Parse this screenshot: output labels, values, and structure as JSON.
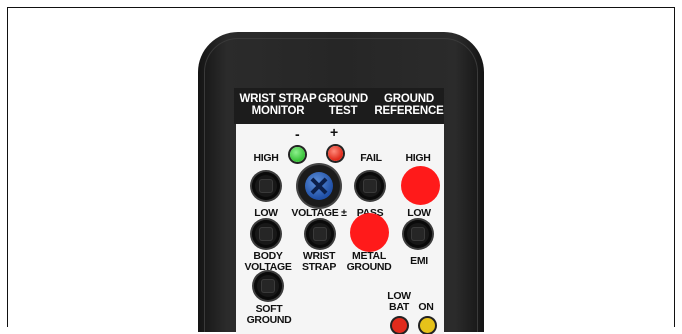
{
  "header": {
    "col1": "WRIST STRAP\nMONITOR",
    "col2": "GROUND\nTEST",
    "col3": "GROUND\nREFERENCE"
  },
  "signs": {
    "minus": "-",
    "plus": "+"
  },
  "labels": {
    "high_left": "HIGH",
    "fail": "FAIL",
    "high_right": "HIGH",
    "low_left": "LOW",
    "voltage": "VOLTAGE ±",
    "pass": "PASS",
    "low_right": "LOW",
    "body_voltage": "BODY\nVOLTAGE",
    "wrist_strap": "WRIST\nSTRAP",
    "metal_ground": "METAL\nGROUND",
    "emi": "EMI",
    "soft_ground": "SOFT\nGROUND",
    "low_bat": "LOW\nBAT",
    "on": "ON"
  },
  "colors": {
    "led_green": "#3ac33a",
    "led_red": "#e02b1c",
    "led_yellow": "#e6c21a",
    "marker_red": "#ff1a1a",
    "knob_blue": "#2f63bf"
  },
  "icons": {
    "knob": "adjust-screw-icon"
  }
}
